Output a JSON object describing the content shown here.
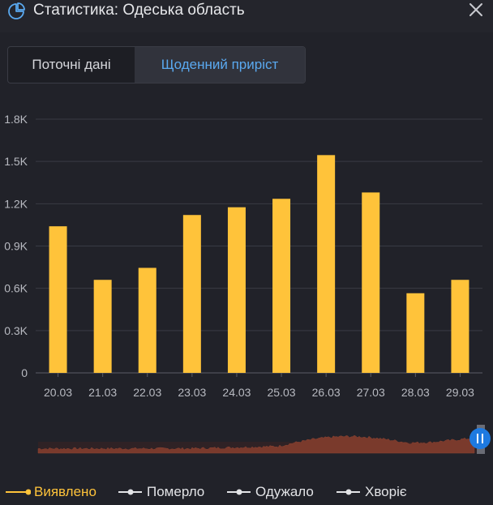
{
  "header": {
    "title": "Статистика: Одеська область"
  },
  "tabs": [
    {
      "label": "Поточні дані",
      "active": false
    },
    {
      "label": "Щоденний приріст",
      "active": true
    }
  ],
  "colors": {
    "bar": "#ffc33a",
    "brush_area": "#7a3a2c",
    "handle": "#1e7ae0",
    "legend_active": "#ffc33a",
    "legend_inactive": "#e2e3e6"
  },
  "chart_data": {
    "type": "bar",
    "categories": [
      "20.03",
      "21.03",
      "22.03",
      "23.03",
      "24.03",
      "25.03",
      "26.03",
      "27.03",
      "28.03",
      "29.03"
    ],
    "series": [
      {
        "name": "Виявлено",
        "values": [
          1040,
          660,
          745,
          1120,
          1175,
          1235,
          1545,
          1280,
          565,
          660
        ]
      }
    ],
    "ylim": [
      0,
      1800
    ],
    "yticks": [
      0,
      300,
      600,
      900,
      1200,
      1500,
      1800
    ],
    "ytick_labels": [
      "0",
      "0.3K",
      "0.6K",
      "0.9K",
      "1.2K",
      "1.5K",
      "1.8K"
    ],
    "grid": true,
    "legend": [
      {
        "label": "Виявлено",
        "active": true
      },
      {
        "label": "Померло",
        "active": false
      },
      {
        "label": "Одужало",
        "active": false
      },
      {
        "label": "Хворіє",
        "active": false
      }
    ]
  }
}
